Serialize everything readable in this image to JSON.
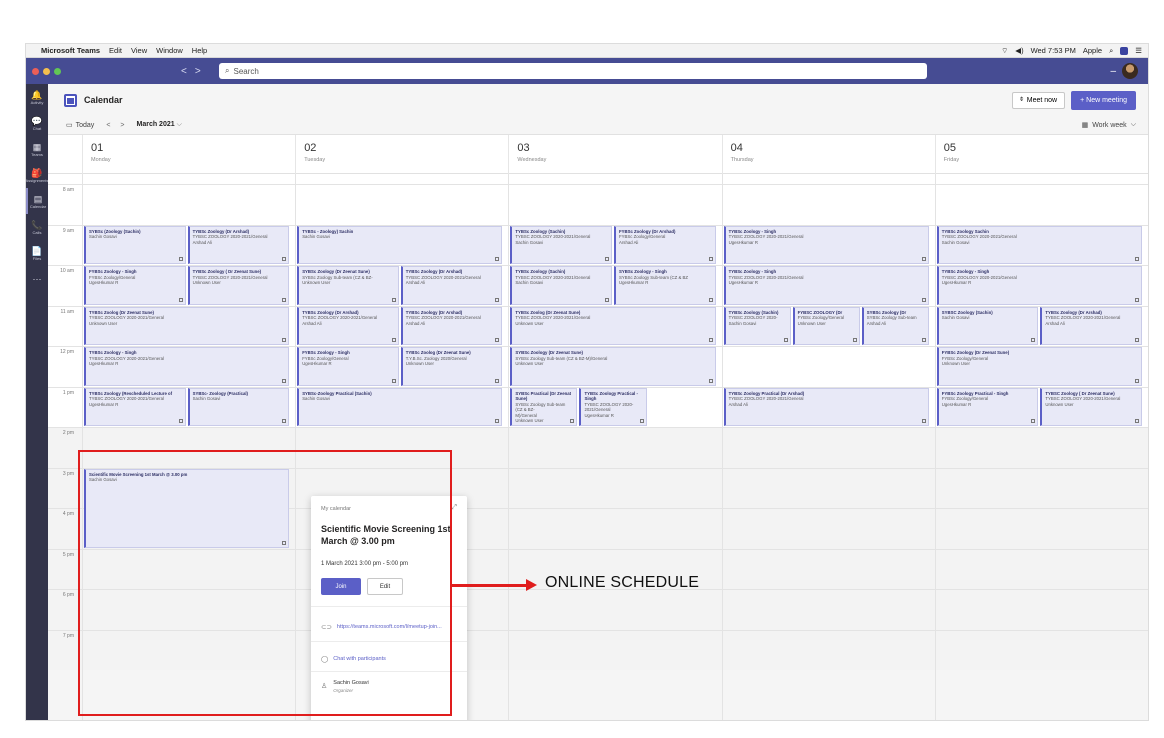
{
  "menubar": {
    "apple_icon": "",
    "app": "Microsoft Teams",
    "items": [
      "Edit",
      "View",
      "Window",
      "Help"
    ],
    "clock": "Wed 7:53 PM",
    "user": "Apple"
  },
  "titlebar": {
    "search_placeholder": "Search",
    "nav_back": "<",
    "nav_forward": ">",
    "minimize": "–"
  },
  "rail": [
    {
      "label": "Activity",
      "icon": "bell-icon",
      "glyph": "🔔"
    },
    {
      "label": "Chat",
      "icon": "chat-icon",
      "glyph": "💬"
    },
    {
      "label": "Teams",
      "icon": "teams-icon",
      "glyph": "▦"
    },
    {
      "label": "Assignments",
      "icon": "assignments-icon",
      "glyph": "🎒"
    },
    {
      "label": "Calendar",
      "icon": "calendar-icon",
      "glyph": "▤"
    },
    {
      "label": "Calls",
      "icon": "phone-icon",
      "glyph": "📞"
    },
    {
      "label": "Files",
      "icon": "file-icon",
      "glyph": "📄"
    },
    {
      "label": "",
      "icon": "more-icon",
      "glyph": "···"
    }
  ],
  "header": {
    "title": "Calendar",
    "meet_now": "Meet now",
    "new_meeting": "+ New meeting"
  },
  "toolbar": {
    "today": "Today",
    "month": "March 2021",
    "view": "Work week"
  },
  "days": [
    {
      "num": "01",
      "name": "Monday"
    },
    {
      "num": "02",
      "name": "Tuesday"
    },
    {
      "num": "03",
      "name": "Wednesday"
    },
    {
      "num": "04",
      "name": "Thursday"
    },
    {
      "num": "05",
      "name": "Friday"
    }
  ],
  "hours": [
    "8 am",
    "9 am",
    "10 am",
    "11 am",
    "12 pm",
    "1 pm",
    "2 pm",
    "3 pm",
    "4 pm",
    "5 pm",
    "6 pm",
    "7 pm"
  ],
  "events": [
    {
      "day": 0,
      "start": 9.0,
      "end": 10.0,
      "slot": 0,
      "slots": 2,
      "title": "SYBSc (Zoology (Sachin)",
      "lines": [
        "Sachin Gosavi"
      ]
    },
    {
      "day": 0,
      "start": 9.0,
      "end": 10.0,
      "slot": 1,
      "slots": 2,
      "title": "TYBSc Zoology (Dr Arshad)",
      "lines": [
        "TYBSC ZOOLOGY 2020-2021/General",
        "Arshad Ali"
      ]
    },
    {
      "day": 0,
      "start": 10.0,
      "end": 11.0,
      "slot": 0,
      "slots": 2,
      "title": "FYBSc Zoology - Singh",
      "lines": [
        "FYBSc Zoology/General",
        "UgesHkumar R"
      ]
    },
    {
      "day": 0,
      "start": 10.0,
      "end": 11.0,
      "slot": 1,
      "slots": 2,
      "title": "TYBSc Zoology ( Dr Zeenat Sune)",
      "lines": [
        "TYBSC ZOOLOGY 2020-2021/General",
        "Unknown User"
      ]
    },
    {
      "day": 0,
      "start": 11.0,
      "end": 12.0,
      "slot": 0,
      "slots": 1,
      "title": "TYBSc Zoolog (Dr Zeenat Sune)",
      "lines": [
        "TYBSC ZOOLOGY 2020-2021/General",
        "Unknown User"
      ]
    },
    {
      "day": 0,
      "start": 12.0,
      "end": 13.0,
      "slot": 0,
      "slots": 1,
      "title": "TYBSc Zoology - Singh",
      "lines": [
        "TYBSC ZOOLOGY 2020-2021/General",
        "UgesHkumar R"
      ]
    },
    {
      "day": 0,
      "start": 13.0,
      "end": 14.0,
      "slot": 0,
      "slots": 2,
      "title": "TYBSc Zoology (Rescheduled Lecture of",
      "lines": [
        "TYBSC ZOOLOGY 2020-2021/General",
        "UgesHkumar R"
      ]
    },
    {
      "day": 0,
      "start": 13.0,
      "end": 14.0,
      "slot": 1,
      "slots": 2,
      "title": "SYBSc- Zoology (Practical)",
      "lines": [
        "Sachin Gosavi"
      ]
    },
    {
      "day": 0,
      "start": 15.0,
      "end": 17.0,
      "slot": 0,
      "slots": 1,
      "title": "Scientific Movie Screening 1st March @ 3.00 pm",
      "lines": [
        "Sachin Gosavi"
      ]
    },
    {
      "day": 1,
      "start": 9.0,
      "end": 10.0,
      "slot": 0,
      "slots": 1,
      "title": "TYBSc - Zoology) Sachin",
      "lines": [
        "Sachin Gosavi"
      ]
    },
    {
      "day": 1,
      "start": 10.0,
      "end": 11.0,
      "slot": 0,
      "slots": 2,
      "title": "SYBSc Zoology (Dr Zeenat Sune)",
      "lines": [
        "SYBSc Zoology Sub-team (CZ & BZ-",
        "Unknown User"
      ]
    },
    {
      "day": 1,
      "start": 10.0,
      "end": 11.0,
      "slot": 1,
      "slots": 2,
      "title": "TYBSc Zoology (Dr Arshad)",
      "lines": [
        "TYBSC ZOOLOGY 2020-2021/General",
        "Arshad Ali"
      ]
    },
    {
      "day": 1,
      "start": 11.0,
      "end": 12.0,
      "slot": 0,
      "slots": 2,
      "title": "TYBSc Zoology (Dr Arshad)",
      "lines": [
        "TYBSC ZOOLOGY 2020-2021/General",
        "Arshad Ali"
      ]
    },
    {
      "day": 1,
      "start": 11.0,
      "end": 12.0,
      "slot": 1,
      "slots": 2,
      "title": "TYBSc Zoology (Dr Arshad)",
      "lines": [
        "TYBSC ZOOLOGY 2020-2021/General",
        "Arshad Ali"
      ]
    },
    {
      "day": 1,
      "start": 12.0,
      "end": 13.0,
      "slot": 0,
      "slots": 2,
      "title": "FYBSc Zoology - Singh",
      "lines": [
        "FYBSc Zoology/General",
        "UgesHkumar R"
      ]
    },
    {
      "day": 1,
      "start": 12.0,
      "end": 13.0,
      "slot": 1,
      "slots": 2,
      "title": "TYBSc Zoolog (Dr Zeenat Sune)",
      "lines": [
        "T.Y.B.Sc. Zoology 2020/General",
        "Unknown User"
      ]
    },
    {
      "day": 1,
      "start": 13.0,
      "end": 14.0,
      "slot": 0,
      "slots": 1,
      "title": "SYBSc-Zoology Practical (Sachin)",
      "lines": [
        "Sachin Gosavi"
      ]
    },
    {
      "day": 2,
      "start": 9.0,
      "end": 10.0,
      "slot": 0,
      "slots": 2,
      "title": "TYBSc Zoology (Sachin)",
      "lines": [
        "TYBSC ZOOLOGY 2020-2021/General",
        "Sachin Gosavi"
      ]
    },
    {
      "day": 2,
      "start": 9.0,
      "end": 10.0,
      "slot": 1,
      "slots": 2,
      "title": "FYBSc Zoology (Dr Arshad)",
      "lines": [
        "FYBSc Zoology/General",
        "Arshad Ali"
      ]
    },
    {
      "day": 2,
      "start": 10.0,
      "end": 11.0,
      "slot": 0,
      "slots": 2,
      "title": "TYBSc Zoology (Sachin)",
      "lines": [
        "TYBSC ZOOLOGY 2020-2021/General",
        "Sachin Gosavi"
      ]
    },
    {
      "day": 2,
      "start": 10.0,
      "end": 11.0,
      "slot": 1,
      "slots": 2,
      "title": "SYBSc Zoology - Singh",
      "lines": [
        "SYBSc Zoology Sub-team (CZ & BZ",
        "UgesHkumar R"
      ]
    },
    {
      "day": 2,
      "start": 11.0,
      "end": 12.0,
      "slot": 0,
      "slots": 1,
      "title": "TYBSc Zoolog (Dr Zeenat Sune)",
      "lines": [
        "TYBSC ZOOLOGY 2020-2021/General",
        "Unknown User"
      ]
    },
    {
      "day": 2,
      "start": 12.0,
      "end": 13.0,
      "slot": 0,
      "slots": 1,
      "title": "SYBSc Zoology (Dr Zeenat Sune)",
      "lines": [
        "SYBSc Zoology Sub-team (CZ & BZ-M)/General",
        "Unknown User"
      ]
    },
    {
      "day": 2,
      "start": 13.0,
      "end": 14.0,
      "slot": 0,
      "slots": 3,
      "title": "SYBSc Practical (Dr Zeenat Sune)",
      "lines": [
        "SYBSc Zoology Sub-team (CZ & BZ-",
        "M)/General",
        "Unknown User"
      ]
    },
    {
      "day": 2,
      "start": 13.0,
      "end": 14.0,
      "slot": 1,
      "slots": 3,
      "title": "TYBSc Zoology Practical - Singh",
      "lines": [
        "TYBSC ZOOLOGY 2020-2021/General",
        "UgesHkumar R"
      ]
    },
    {
      "day": 3,
      "start": 9.0,
      "end": 10.0,
      "slot": 0,
      "slots": 1,
      "title": "TYBSc Zoology - Singh",
      "lines": [
        "TYBSC ZOOLOGY 2020-2021/General",
        "UgesHkumar R"
      ]
    },
    {
      "day": 3,
      "start": 10.0,
      "end": 11.0,
      "slot": 0,
      "slots": 1,
      "title": "TYBSc Zoology - Singh",
      "lines": [
        "TYBSC ZOOLOGY 2020-2021/General",
        "UgesHkumar R"
      ]
    },
    {
      "day": 3,
      "start": 11.0,
      "end": 12.0,
      "slot": 0,
      "slots": 3,
      "title": "TYBSc Zoology (Sachin)",
      "lines": [
        "TYBSC ZOOLOGY 2020-",
        "Sachin Gosavi"
      ]
    },
    {
      "day": 3,
      "start": 11.0,
      "end": 12.0,
      "slot": 1,
      "slots": 3,
      "title": "FYBSC ZOOLOGY (Dr",
      "lines": [
        "FYBSc Zoology/General",
        "Unknown User"
      ]
    },
    {
      "day": 3,
      "start": 11.0,
      "end": 12.0,
      "slot": 2,
      "slots": 3,
      "title": "SYBSc Zoology (Dr",
      "lines": [
        "SYBSc Zoology Sub-team",
        "Arshad Ali"
      ]
    },
    {
      "day": 3,
      "start": 13.0,
      "end": 14.0,
      "slot": 0,
      "slots": 1,
      "title": "TYBSc Zoology Practical (Dr Arshad)",
      "lines": [
        "TYBSC ZOOLOGY 2020-2021/General",
        "Arshad Ali"
      ]
    },
    {
      "day": 4,
      "start": 9.0,
      "end": 10.0,
      "slot": 0,
      "slots": 1,
      "title": "TYBSc Zoology Sachin",
      "lines": [
        "TYBSC ZOOLOGY 2020-2021/General",
        "Sachin Gosavi"
      ]
    },
    {
      "day": 4,
      "start": 10.0,
      "end": 11.0,
      "slot": 0,
      "slots": 1,
      "title": "TYBSc Zoology - Singh",
      "lines": [
        "TYBSC ZOOLOGY 2020-2021/General",
        "UgesHkumar R"
      ]
    },
    {
      "day": 4,
      "start": 11.0,
      "end": 12.0,
      "slot": 0,
      "slots": 2,
      "title": "SYBSC Zoology (Sachin)",
      "lines": [
        "Sachin Gosavi"
      ]
    },
    {
      "day": 4,
      "start": 11.0,
      "end": 12.0,
      "slot": 1,
      "slots": 2,
      "title": "TYBSc Zoology (Dr Arshad)",
      "lines": [
        "TYBSC ZOOLOGY 2020-2021/General",
        "Arshad Ali"
      ]
    },
    {
      "day": 4,
      "start": 12.0,
      "end": 13.0,
      "slot": 0,
      "slots": 1,
      "title": "FYBSc Zoology (Dr Zeenat Sune)",
      "lines": [
        "FYBSc Zoology/General",
        "Unknown User"
      ]
    },
    {
      "day": 4,
      "start": 13.0,
      "end": 14.0,
      "slot": 0,
      "slots": 2,
      "title": "FYBSc Zoology Practical - Singh",
      "lines": [
        "FYBSc Zoology/General",
        "UgesHkumar R"
      ]
    },
    {
      "day": 4,
      "start": 13.0,
      "end": 14.0,
      "slot": 1,
      "slots": 2,
      "title": "TYBSC Zoology ( Dr Zeenat Sune)",
      "lines": [
        "TYBSC ZOOLOGY 2020-2021/General",
        "Unknown User"
      ]
    }
  ],
  "popup": {
    "calendar": "My calendar",
    "title": "Scientific Movie Screening 1st March @ 3.00 pm",
    "time": "1 March 2021 3:00 pm - 5:00 pm",
    "join": "Join",
    "edit": "Edit",
    "link": "https://teams.microsoft.com/l/meetup-join...",
    "chat": "Chat with participants",
    "organizer": "Sachin Gosavi",
    "organizer_role": "Organizer"
  },
  "annotation": {
    "label": "ONLINE SCHEDULE",
    "color": "#e01d1d"
  },
  "colors": {
    "accent": "#5b5fc7",
    "titlebar": "#464c93",
    "rail": "#33344a",
    "event_bg": "#e8e9f7"
  }
}
